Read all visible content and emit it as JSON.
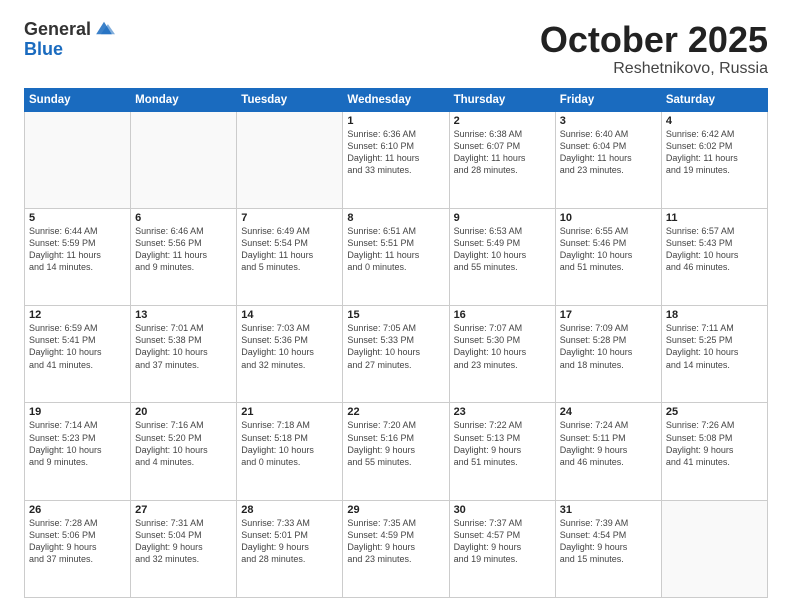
{
  "logo": {
    "general": "General",
    "blue": "Blue"
  },
  "header": {
    "month": "October 2025",
    "location": "Reshetnikovo, Russia"
  },
  "days_of_week": [
    "Sunday",
    "Monday",
    "Tuesday",
    "Wednesday",
    "Thursday",
    "Friday",
    "Saturday"
  ],
  "weeks": [
    [
      {
        "day": "",
        "info": ""
      },
      {
        "day": "",
        "info": ""
      },
      {
        "day": "",
        "info": ""
      },
      {
        "day": "1",
        "info": "Sunrise: 6:36 AM\nSunset: 6:10 PM\nDaylight: 11 hours\nand 33 minutes."
      },
      {
        "day": "2",
        "info": "Sunrise: 6:38 AM\nSunset: 6:07 PM\nDaylight: 11 hours\nand 28 minutes."
      },
      {
        "day": "3",
        "info": "Sunrise: 6:40 AM\nSunset: 6:04 PM\nDaylight: 11 hours\nand 23 minutes."
      },
      {
        "day": "4",
        "info": "Sunrise: 6:42 AM\nSunset: 6:02 PM\nDaylight: 11 hours\nand 19 minutes."
      }
    ],
    [
      {
        "day": "5",
        "info": "Sunrise: 6:44 AM\nSunset: 5:59 PM\nDaylight: 11 hours\nand 14 minutes."
      },
      {
        "day": "6",
        "info": "Sunrise: 6:46 AM\nSunset: 5:56 PM\nDaylight: 11 hours\nand 9 minutes."
      },
      {
        "day": "7",
        "info": "Sunrise: 6:49 AM\nSunset: 5:54 PM\nDaylight: 11 hours\nand 5 minutes."
      },
      {
        "day": "8",
        "info": "Sunrise: 6:51 AM\nSunset: 5:51 PM\nDaylight: 11 hours\nand 0 minutes."
      },
      {
        "day": "9",
        "info": "Sunrise: 6:53 AM\nSunset: 5:49 PM\nDaylight: 10 hours\nand 55 minutes."
      },
      {
        "day": "10",
        "info": "Sunrise: 6:55 AM\nSunset: 5:46 PM\nDaylight: 10 hours\nand 51 minutes."
      },
      {
        "day": "11",
        "info": "Sunrise: 6:57 AM\nSunset: 5:43 PM\nDaylight: 10 hours\nand 46 minutes."
      }
    ],
    [
      {
        "day": "12",
        "info": "Sunrise: 6:59 AM\nSunset: 5:41 PM\nDaylight: 10 hours\nand 41 minutes."
      },
      {
        "day": "13",
        "info": "Sunrise: 7:01 AM\nSunset: 5:38 PM\nDaylight: 10 hours\nand 37 minutes."
      },
      {
        "day": "14",
        "info": "Sunrise: 7:03 AM\nSunset: 5:36 PM\nDaylight: 10 hours\nand 32 minutes."
      },
      {
        "day": "15",
        "info": "Sunrise: 7:05 AM\nSunset: 5:33 PM\nDaylight: 10 hours\nand 27 minutes."
      },
      {
        "day": "16",
        "info": "Sunrise: 7:07 AM\nSunset: 5:30 PM\nDaylight: 10 hours\nand 23 minutes."
      },
      {
        "day": "17",
        "info": "Sunrise: 7:09 AM\nSunset: 5:28 PM\nDaylight: 10 hours\nand 18 minutes."
      },
      {
        "day": "18",
        "info": "Sunrise: 7:11 AM\nSunset: 5:25 PM\nDaylight: 10 hours\nand 14 minutes."
      }
    ],
    [
      {
        "day": "19",
        "info": "Sunrise: 7:14 AM\nSunset: 5:23 PM\nDaylight: 10 hours\nand 9 minutes."
      },
      {
        "day": "20",
        "info": "Sunrise: 7:16 AM\nSunset: 5:20 PM\nDaylight: 10 hours\nand 4 minutes."
      },
      {
        "day": "21",
        "info": "Sunrise: 7:18 AM\nSunset: 5:18 PM\nDaylight: 10 hours\nand 0 minutes."
      },
      {
        "day": "22",
        "info": "Sunrise: 7:20 AM\nSunset: 5:16 PM\nDaylight: 9 hours\nand 55 minutes."
      },
      {
        "day": "23",
        "info": "Sunrise: 7:22 AM\nSunset: 5:13 PM\nDaylight: 9 hours\nand 51 minutes."
      },
      {
        "day": "24",
        "info": "Sunrise: 7:24 AM\nSunset: 5:11 PM\nDaylight: 9 hours\nand 46 minutes."
      },
      {
        "day": "25",
        "info": "Sunrise: 7:26 AM\nSunset: 5:08 PM\nDaylight: 9 hours\nand 41 minutes."
      }
    ],
    [
      {
        "day": "26",
        "info": "Sunrise: 7:28 AM\nSunset: 5:06 PM\nDaylight: 9 hours\nand 37 minutes."
      },
      {
        "day": "27",
        "info": "Sunrise: 7:31 AM\nSunset: 5:04 PM\nDaylight: 9 hours\nand 32 minutes."
      },
      {
        "day": "28",
        "info": "Sunrise: 7:33 AM\nSunset: 5:01 PM\nDaylight: 9 hours\nand 28 minutes."
      },
      {
        "day": "29",
        "info": "Sunrise: 7:35 AM\nSunset: 4:59 PM\nDaylight: 9 hours\nand 23 minutes."
      },
      {
        "day": "30",
        "info": "Sunrise: 7:37 AM\nSunset: 4:57 PM\nDaylight: 9 hours\nand 19 minutes."
      },
      {
        "day": "31",
        "info": "Sunrise: 7:39 AM\nSunset: 4:54 PM\nDaylight: 9 hours\nand 15 minutes."
      },
      {
        "day": "",
        "info": ""
      }
    ]
  ]
}
